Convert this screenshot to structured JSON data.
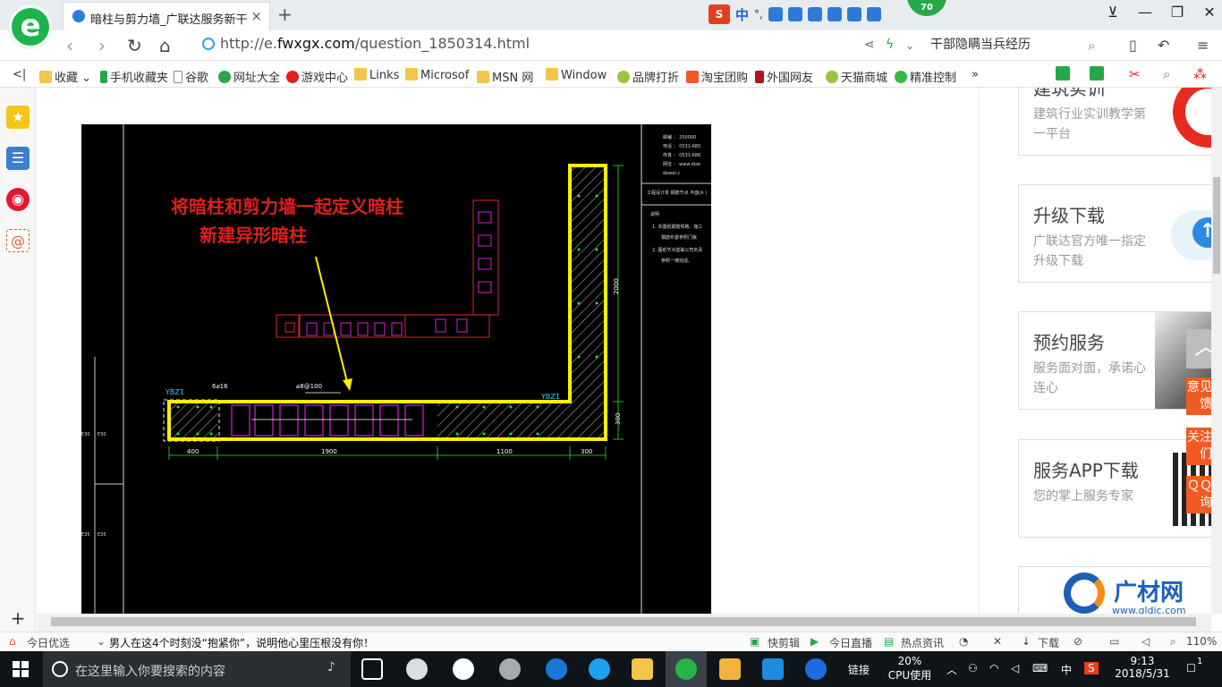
{
  "browser": {
    "tab_title": "暗柱与剪力墙_广联达服务新干线",
    "tab_close": "×",
    "new_tab": "+",
    "logo_letter": "e",
    "badge_count": "70",
    "ime": {
      "brand": "S",
      "lang": "中",
      "punct": "°,"
    },
    "url_prefix": "http://e.",
    "url_domain": "fwxgx.com",
    "url_path": "/question_1850314.html",
    "search_text": "干部隐瞒当兵经历",
    "window_controls": [
      "⊻",
      "—",
      "❐",
      "✕"
    ]
  },
  "bookmarks": [
    {
      "label": "收藏",
      "icon": "star-icon"
    },
    {
      "label": "手机收藏夹",
      "icon": "phone-icon"
    },
    {
      "label": "谷歌",
      "icon": "page-icon"
    },
    {
      "label": "网址大全",
      "icon": "globe-icon"
    },
    {
      "label": "游戏中心",
      "icon": "game-icon"
    },
    {
      "label": "Links",
      "icon": "folder-icon"
    },
    {
      "label": "Microsof",
      "icon": "folder-icon"
    },
    {
      "label": "MSN 网",
      "icon": "folder-icon"
    },
    {
      "label": "Window",
      "icon": "folder-icon"
    },
    {
      "label": "品牌打折",
      "icon": "leaf-icon"
    },
    {
      "label": "淘宝团购",
      "icon": "taobao-icon"
    },
    {
      "label": "外国网友",
      "icon": "bookmark-icon"
    },
    {
      "label": "天猫商城",
      "icon": "leaf-icon"
    },
    {
      "label": "精准控制",
      "icon": "wechat-icon"
    }
  ],
  "cad": {
    "note_line1": "将暗柱和剪力墙一起定义暗柱",
    "note_line2": "新建异形暗柱",
    "label_ybz1_left": "YBZ1",
    "label_ybz1_right": "YBZ1",
    "label_rebar_a": "6⌀16",
    "label_rebar_b": "⌀8@100",
    "dim_400": "400",
    "dim_1900": "1900",
    "dim_1100": "1100",
    "dim_300": "300",
    "dim_2000": "2000",
    "dim_v300": "300",
    "side_a": "E30",
    "side_b": "E35",
    "notes_title": "工程设计单 钢筋节点 平面(A )",
    "notes_head": "说明",
    "notes_1": "1. 本图纸钢筋规格、施工",
    "notes_2": "钢筋布置参照门板",
    "notes_3": "2. 图纸节点基础公司负责",
    "notes_4": "参照一律完成。",
    "tel_lines": [
      "邮编  ：  250000",
      "电话  ：  0531-685",
      "传真  ：  0531-686",
      "网址  ：  www.dow",
      "          dowei.c"
    ]
  },
  "right_cards": [
    {
      "title": "建筑实训",
      "desc": "建筑行业实训教学第一平台"
    },
    {
      "title": "升级下载",
      "desc": "广联达官方唯一指定升级下载"
    },
    {
      "title": "预约服务",
      "desc": "服务面对面，承诺心连心"
    },
    {
      "title": "服务APP下载",
      "desc": "您的掌上服务专家"
    },
    {
      "title": "广材网",
      "desc": "www.gldjc.com"
    }
  ],
  "floating": {
    "feedback": "意见反馈",
    "follow": "关注我们",
    "qq": "ＱＱ咨询"
  },
  "status": {
    "today_pick": "今日优选",
    "headline": "男人在这4个时刻没“抱紧你”，说明他心里压根没有你！",
    "quick_cut": "快剪辑",
    "today_live": "今日直播",
    "hot_news": "热点资讯",
    "download": "下载",
    "zoom": "110%"
  },
  "taskbar": {
    "search_placeholder": "在这里输入你要搜索的内容",
    "link": "链接",
    "cpu_pct": "20%",
    "cpu_label": "CPU使用",
    "ime": "中",
    "time": "9:13",
    "date": "2018/5/31",
    "notif": "1"
  }
}
